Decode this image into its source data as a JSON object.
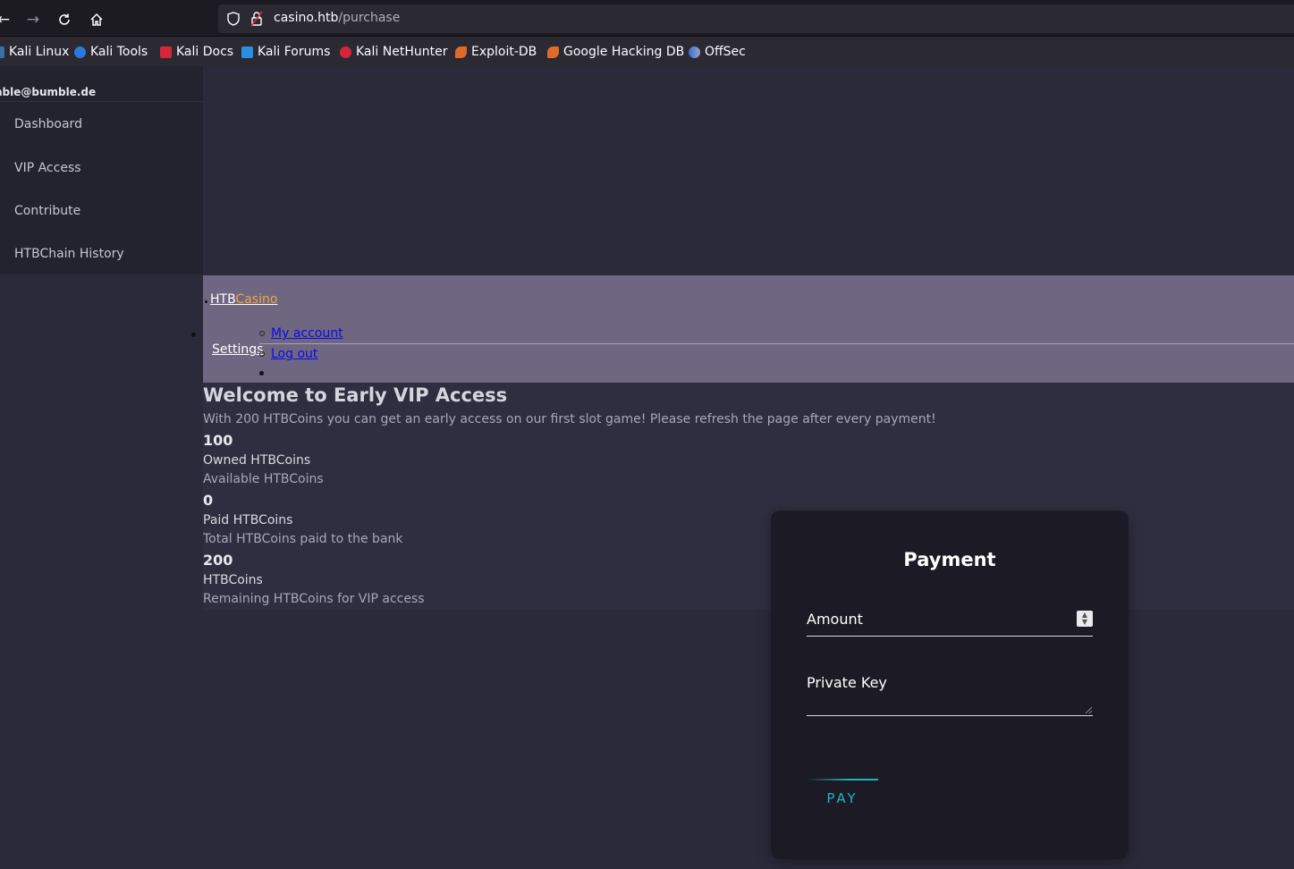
{
  "browser": {
    "url_host": "casino.htb",
    "url_path": "/purchase",
    "bookmarks": [
      {
        "label": "Kali Linux",
        "icon": "kali-dragon-icon"
      },
      {
        "label": "Kali Tools",
        "icon": "kali-tools-icon"
      },
      {
        "label": "Kali Docs",
        "icon": "kali-docs-icon"
      },
      {
        "label": "Kali Forums",
        "icon": "kali-forums-icon"
      },
      {
        "label": "Kali NetHunter",
        "icon": "kali-nethunter-icon"
      },
      {
        "label": "Exploit-DB",
        "icon": "exploit-db-icon"
      },
      {
        "label": "Google Hacking DB",
        "icon": "ghdb-icon"
      },
      {
        "label": "OffSec",
        "icon": "offsec-icon"
      }
    ]
  },
  "sidebar": {
    "email": "nble@bumble.de",
    "items": [
      {
        "label": "Dashboard"
      },
      {
        "label": "VIP Access"
      },
      {
        "label": "Contribute"
      },
      {
        "label": "HTBChain History"
      }
    ]
  },
  "topnav": {
    "brand_prefix": "HTB",
    "brand_suffix": "Casino",
    "settings": "Settings",
    "my_account": "My account",
    "log_out": "Log out"
  },
  "main": {
    "title": "Welcome to Early VIP Access",
    "subtitle": "With 200 HTBCoins you can get an early access on our first slot game! Please refresh the page after every payment!",
    "stats": [
      {
        "value": "100",
        "label": "Owned HTBCoins",
        "desc": "Available HTBCoins"
      },
      {
        "value": "0",
        "label": "Paid HTBCoins",
        "desc": "Total HTBCoins paid to the bank"
      },
      {
        "value": "200",
        "label": "HTBCoins",
        "desc": "Remaining HTBCoins for VIP access"
      }
    ]
  },
  "payment": {
    "title": "Payment",
    "amount_label": "Amount",
    "private_key_label": "Private Key",
    "pay_button": "PAY"
  },
  "colors": {
    "accent": "#1fb2c4",
    "brand_orange": "#f0a63a",
    "link_blue": "#0a0ae6"
  }
}
